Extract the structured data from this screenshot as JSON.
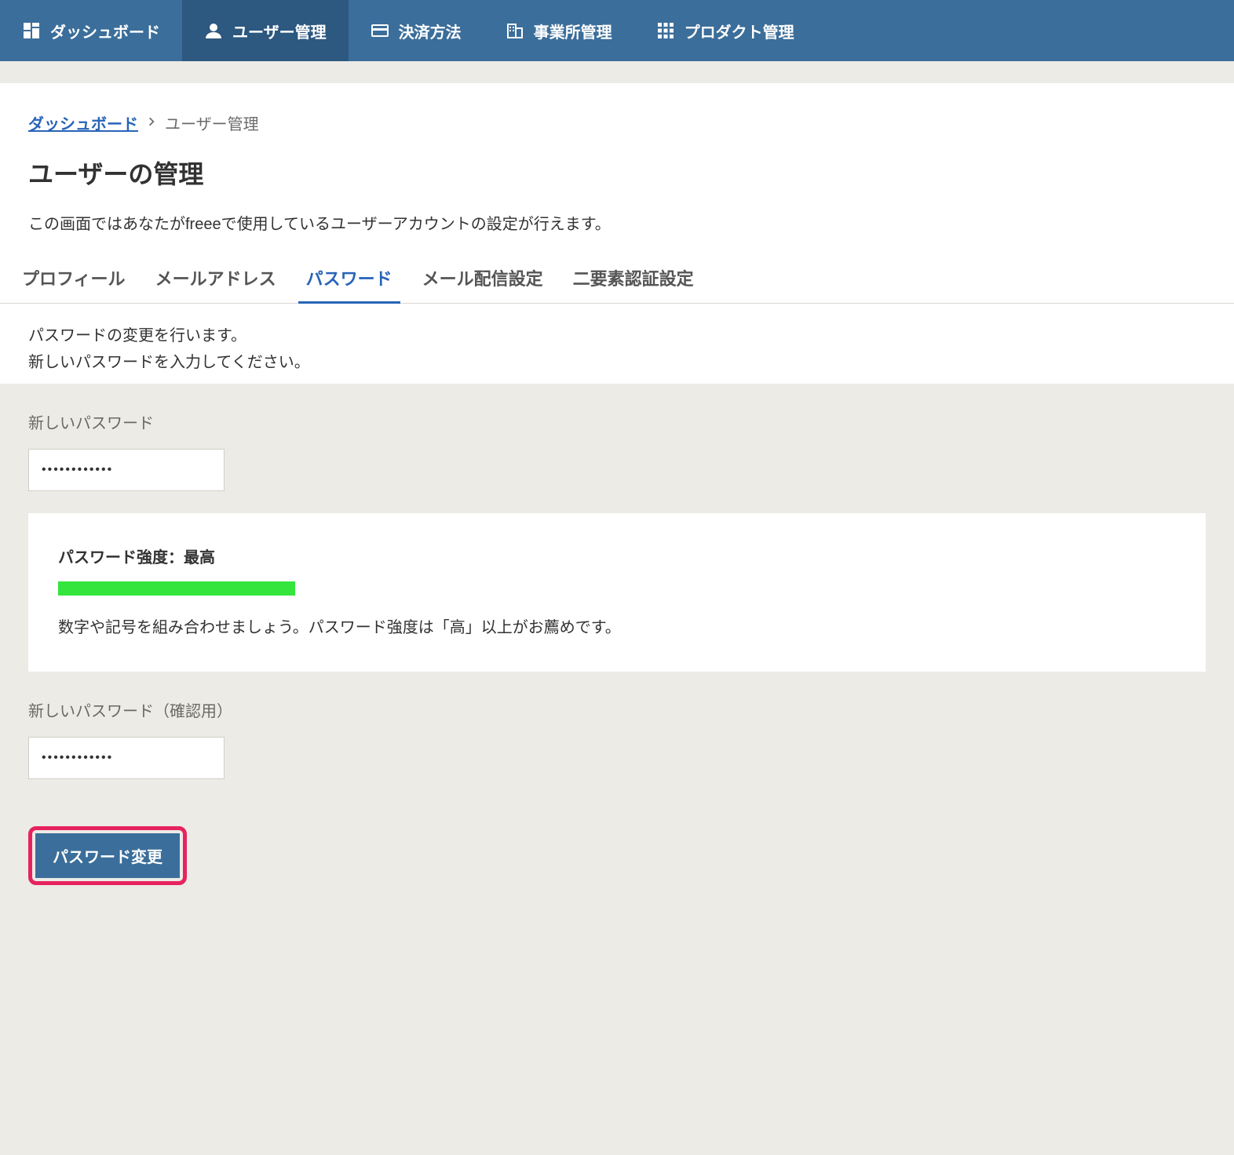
{
  "nav": {
    "items": [
      {
        "label": "ダッシュボード"
      },
      {
        "label": "ユーザー管理"
      },
      {
        "label": "決済方法"
      },
      {
        "label": "事業所管理"
      },
      {
        "label": "プロダクト管理"
      }
    ]
  },
  "breadcrumb": {
    "link_label": "ダッシュボード",
    "current_label": "ユーザー管理"
  },
  "page": {
    "title": "ユーザーの管理",
    "description": "この画面ではあなたがfreeeで使用しているユーザーアカウントの設定が行えます。"
  },
  "tabs": {
    "items": [
      {
        "label": "プロフィール"
      },
      {
        "label": "メールアドレス"
      },
      {
        "label": "パスワード"
      },
      {
        "label": "メール配信設定"
      },
      {
        "label": "二要素認証設定"
      }
    ]
  },
  "password_section": {
    "line1": "パスワードの変更を行います。",
    "line2": "新しいパスワードを入力してください。",
    "new_password_label": "新しいパスワード",
    "new_password_value": "••••••••••••",
    "strength_label": "パスワード強度：最高",
    "strength_percent": 100,
    "strength_hint": "数字や記号を組み合わせましょう。パスワード強度は「高」以上がお薦めです。",
    "confirm_label": "新しいパスワード（確認用）",
    "confirm_value": "••••••••••••",
    "submit_label": "パスワード変更"
  },
  "colors": {
    "nav_bg": "#3b6e9a",
    "nav_active_bg": "#2d5880",
    "accent": "#2864b9",
    "strength_fill": "#33e53c",
    "highlight_border": "#e6225f"
  }
}
